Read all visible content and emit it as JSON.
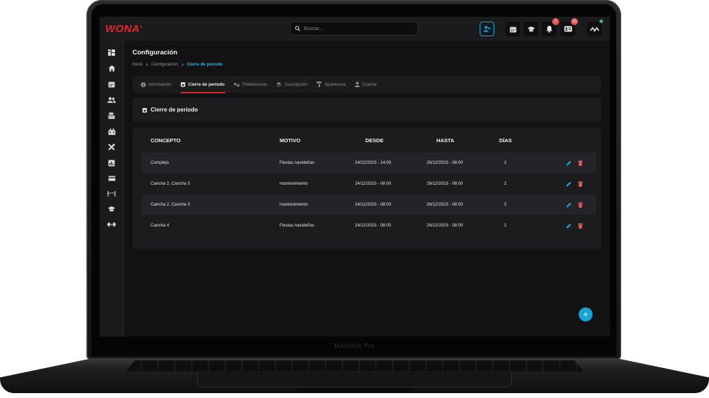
{
  "device": {
    "brand_text": "Macbook Pro"
  },
  "app": {
    "logo_text": "WONA",
    "logo_mark": "®",
    "search": {
      "placeholder": "Buscar..."
    },
    "topbar_buttons": [
      {
        "name": "add-user",
        "icon": "person-add-icon"
      },
      {
        "name": "calendar",
        "icon": "calendar-icon"
      },
      {
        "name": "academy",
        "icon": "graduation-cap-icon"
      },
      {
        "name": "notifications",
        "icon": "bell-icon",
        "badge": "2"
      },
      {
        "name": "id-card",
        "icon": "id-card-icon",
        "badge": "10"
      },
      {
        "name": "profile",
        "icon": "logo-avatar-icon"
      }
    ],
    "sidebar_icons": [
      "dashboard-icon",
      "home-icon",
      "calendar-icon",
      "users-icon",
      "cashier-icon",
      "store-icon",
      "tools-icon",
      "chart-icon",
      "card-icon",
      "court-icon",
      "graduation-cap-icon",
      "dumbbell-icon"
    ]
  },
  "page": {
    "title": "Configuración",
    "breadcrumb": [
      "Inicio",
      "Configuración",
      "Cierre de período"
    ]
  },
  "tabs": [
    {
      "label": "Información",
      "icon": "info-icon",
      "active": false
    },
    {
      "label": "Cierre de período",
      "icon": "calendar-lock-icon",
      "active": true
    },
    {
      "label": "Preferencias",
      "icon": "sliders-icon",
      "active": false
    },
    {
      "label": "Suscripción",
      "icon": "layers-icon",
      "active": false
    },
    {
      "label": "Apariencia",
      "icon": "paint-roller-icon",
      "active": false
    },
    {
      "label": "Cuenta",
      "icon": "user-icon",
      "active": false
    }
  ],
  "section": {
    "title": "Cierre de período"
  },
  "table": {
    "headers": [
      "CONCEPTO",
      "MOTIVO",
      "DESDE",
      "HASTA",
      "DÍAS"
    ],
    "rows": [
      {
        "concepto": "Complejo",
        "motivo": "Fiestas navideñas",
        "desde": "24/12/2023 - 14:00",
        "hasta": "26/12/2023 - 08:00",
        "dias": "2"
      },
      {
        "concepto": "Cancha 2, Cancha 3",
        "motivo": "mantenimiento",
        "desde": "24/12/2023 - 08:00",
        "hasta": "26/12/2023 - 08:00",
        "dias": "2"
      },
      {
        "concepto": "Cancha 2, Cancha 3",
        "motivo": "mantenimiento",
        "desde": "24/12/2023 - 08:00",
        "hasta": "26/12/2023 - 08:00",
        "dias": "2"
      },
      {
        "concepto": "Cancha 4",
        "motivo": "Fiestas navideñas",
        "desde": "24/12/2023 - 08:00",
        "hasta": "26/12/2023 - 08:00",
        "dias": "2"
      }
    ]
  },
  "fab": {
    "label": "+"
  },
  "colors": {
    "accent": "#1aa3d6",
    "brand": "#e5242b",
    "danger": "#e0575b"
  }
}
